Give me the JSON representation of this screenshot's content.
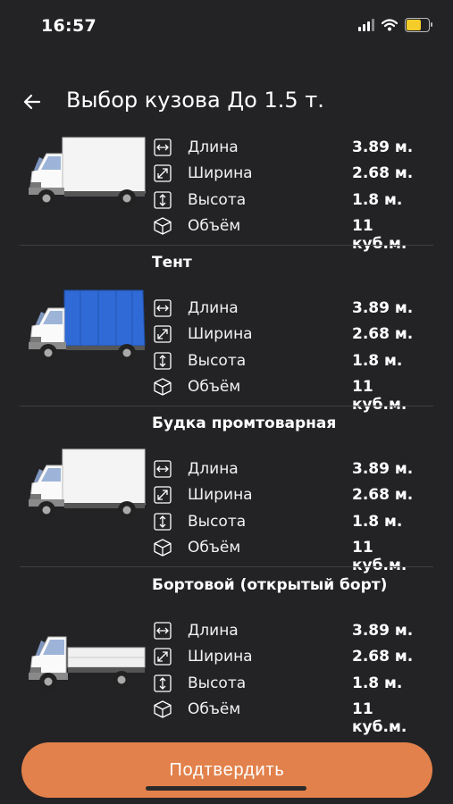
{
  "status": {
    "time": "16:57"
  },
  "header": {
    "title": "Выбор кузова До 1.5 т."
  },
  "colors": {
    "background": "#232326",
    "accent": "#e2814b",
    "battery": "#f4cd2a",
    "tent_blue": "#2f6ad6"
  },
  "icons": {
    "back": "arrow-left-icon",
    "length": "horizontal-arrows-icon",
    "width": "diagonal-arrows-icon",
    "height": "vertical-arrows-icon",
    "volume": "cube-icon"
  },
  "bodies": [
    {
      "title": "",
      "truck": "box-van",
      "specs": [
        {
          "label": "Длина",
          "value": "3.89 м."
        },
        {
          "label": "Ширина",
          "value": "2.68 м."
        },
        {
          "label": "Высота",
          "value": "1.8 м."
        },
        {
          "label": "Объём",
          "value": "11 куб.м."
        }
      ]
    },
    {
      "title": "Тент",
      "truck": "tent",
      "specs": [
        {
          "label": "Длина",
          "value": "3.89 м."
        },
        {
          "label": "Ширина",
          "value": "2.68 м."
        },
        {
          "label": "Высота",
          "value": "1.8 м."
        },
        {
          "label": "Объём",
          "value": "11 куб.м."
        }
      ]
    },
    {
      "title": "Будка промтоварная",
      "truck": "box-van",
      "specs": [
        {
          "label": "Длина",
          "value": "3.89 м."
        },
        {
          "label": "Ширина",
          "value": "2.68 м."
        },
        {
          "label": "Высота",
          "value": "1.8 м."
        },
        {
          "label": "Объём",
          "value": "11 куб.м."
        }
      ]
    },
    {
      "title": "Бортовой (открытый борт)",
      "truck": "flatbed",
      "specs": [
        {
          "label": "Длина",
          "value": "3.89 м."
        },
        {
          "label": "Ширина",
          "value": "2.68 м."
        },
        {
          "label": "Высота",
          "value": "1.8 м."
        },
        {
          "label": "Объём",
          "value": "11 куб.м."
        }
      ]
    }
  ],
  "confirm_button": {
    "label": "Подтвердить"
  }
}
